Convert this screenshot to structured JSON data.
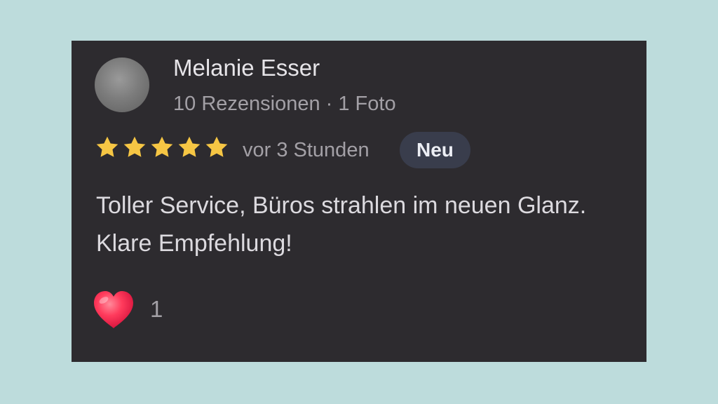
{
  "review": {
    "author_name": "Melanie Esser",
    "author_meta": "10 Rezensionen · 1 Foto",
    "rating": 5,
    "rating_max": 5,
    "time_ago": "vor 3 Stunden",
    "badge": "Neu",
    "text_line1": "Toller Service, Büros strahlen im neuen Glanz.",
    "text_line2": "Klare Empfehlung!",
    "reaction_icon": "heart-icon",
    "reaction_count": "1"
  },
  "colors": {
    "background": "#bddcdc",
    "card": "#2d2b2f",
    "star": "#f6c644",
    "badge": "#393d4c",
    "heart": "#ff2d4f"
  }
}
